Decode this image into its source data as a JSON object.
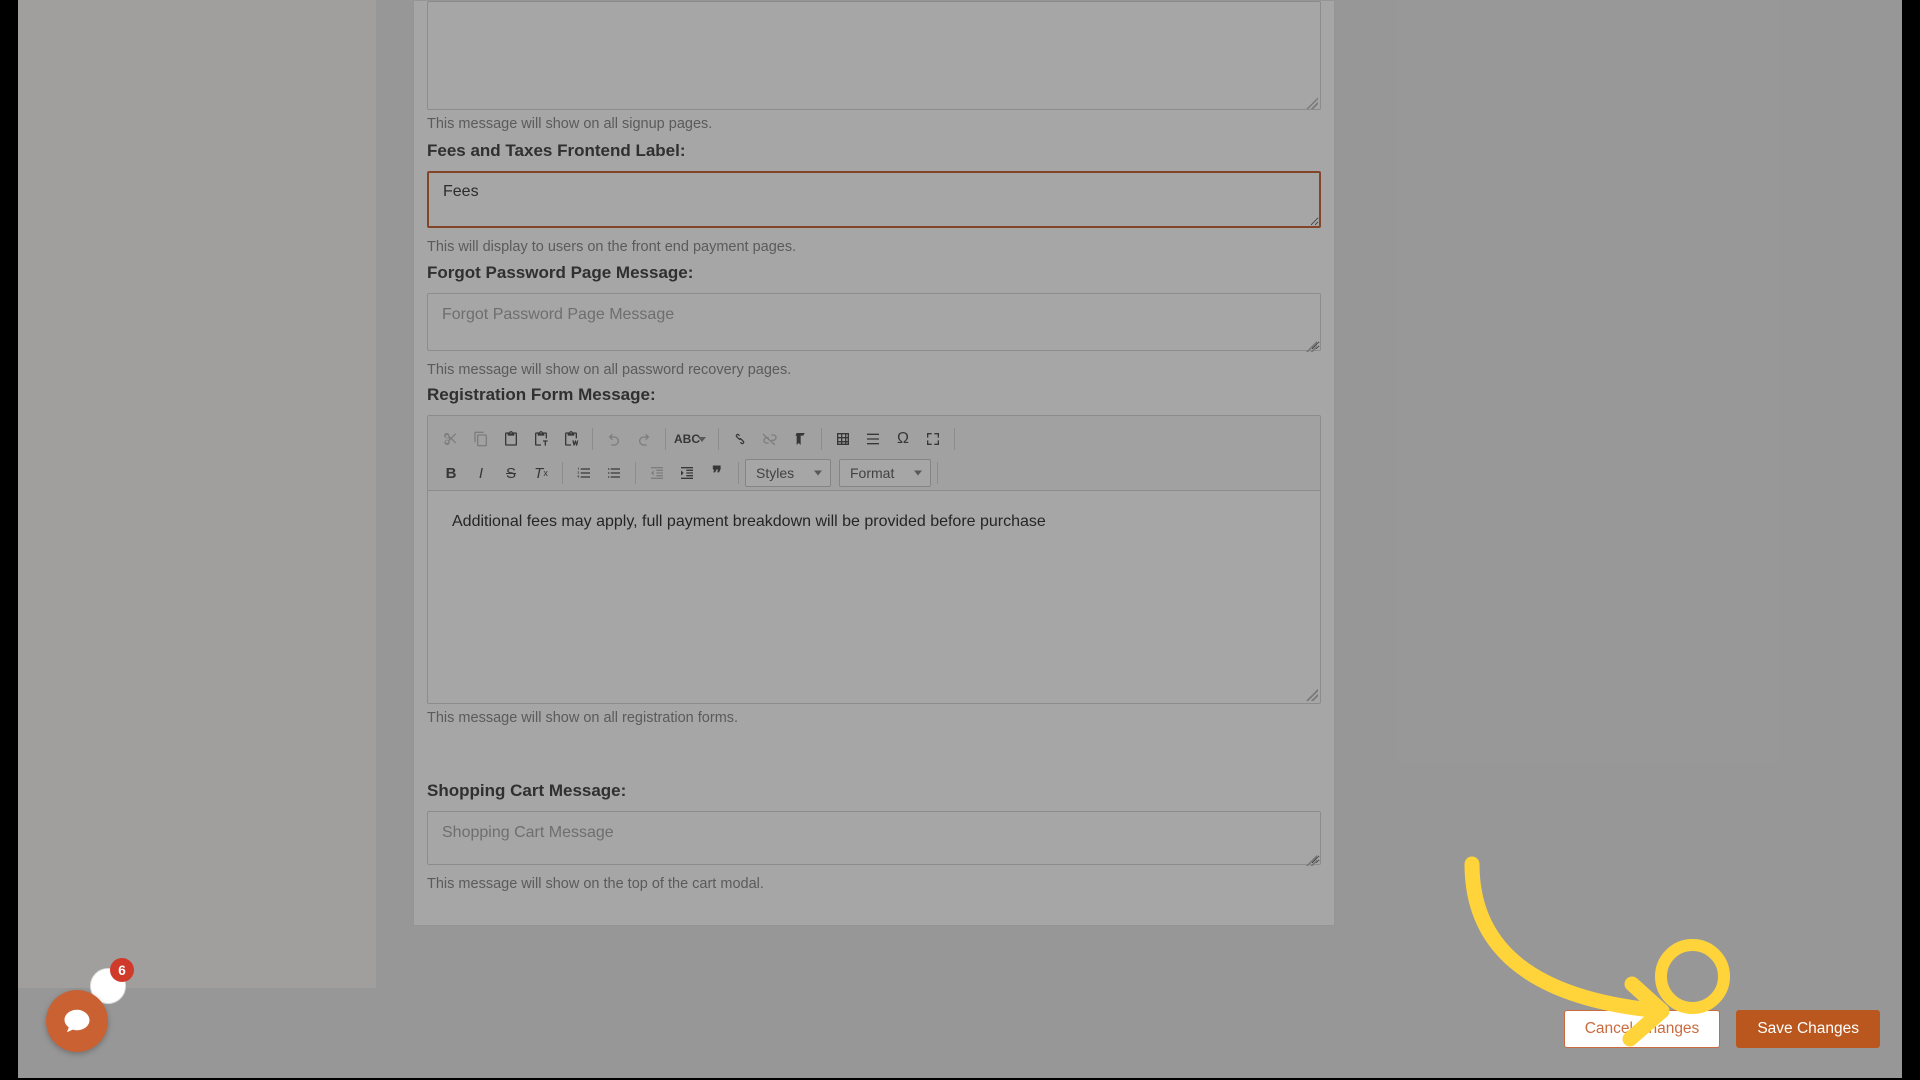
{
  "editor1": {
    "helper": "This message will show on all signup pages."
  },
  "fees": {
    "label": "Fees and Taxes Frontend Label:",
    "value": "Fees",
    "helper": "This will display to users on the front end payment pages."
  },
  "forgot": {
    "label": "Forgot Password Page Message:",
    "placeholder": "Forgot Password Page Message",
    "value": "",
    "helper": "This message will show on all password recovery pages."
  },
  "registration": {
    "label": "Registration Form Message:",
    "content": "Additional fees may apply, full payment breakdown will be provided before purchase",
    "helper": "This message will show on all registration forms.",
    "toolbar": {
      "styles": "Styles",
      "format": "Format"
    }
  },
  "cart": {
    "label": "Shopping Cart Message:",
    "placeholder": "Shopping Cart Message",
    "value": "",
    "helper": "This message will show on the top of the cart modal."
  },
  "actions": {
    "cancel": "Cancel Changes",
    "save": "Save Changes"
  },
  "chat": {
    "badge": "6"
  }
}
